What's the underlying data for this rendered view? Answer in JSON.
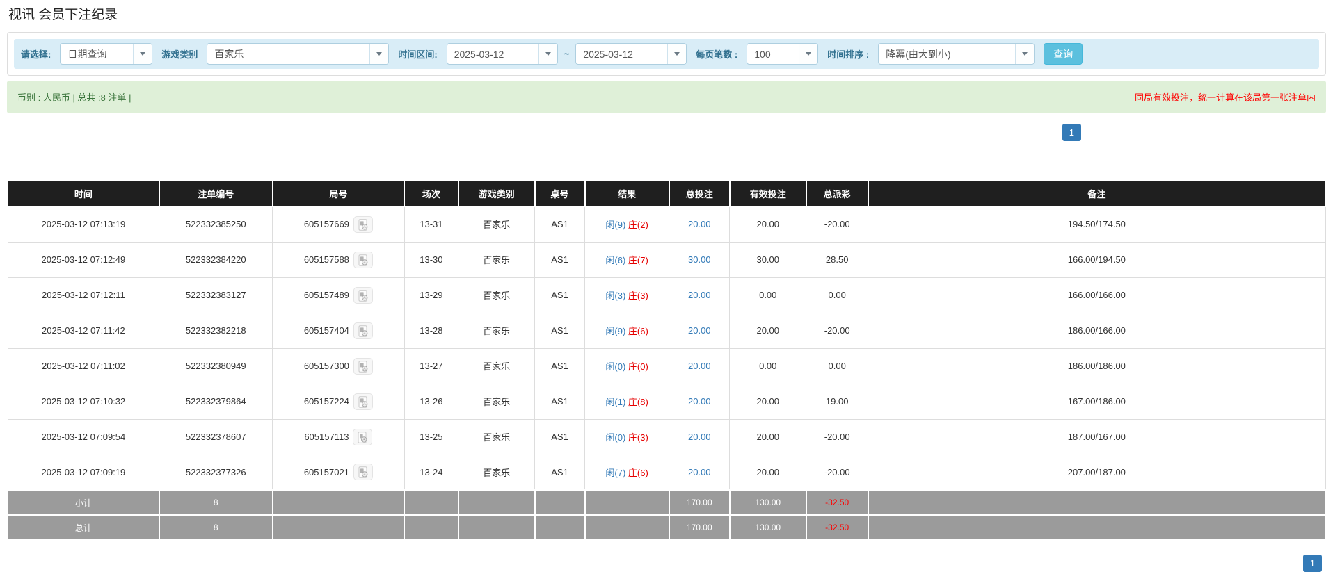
{
  "page": {
    "title": "视讯 会员下注纪录"
  },
  "filters": {
    "select_label": "请选择:",
    "select_value": "日期查询",
    "game_type_label": "游戏类别",
    "game_type_value": "百家乐",
    "date_range_label": "时间区间:",
    "date_from": "2025-03-12",
    "date_to": "2025-03-12",
    "range_separator": "~",
    "page_size_label": "每页笔数 :",
    "page_size_value": "100",
    "sort_label": "时间排序 :",
    "sort_value": "降冪(由大到小)",
    "search_button": "查询"
  },
  "summary": {
    "left_text": "币别 : 人民币 | 总共 :8 注单 |",
    "right_notice": "同局有效投注，统一计算在该局第一张注单内"
  },
  "pagination": {
    "current_page": "1"
  },
  "table": {
    "headers": [
      "时间",
      "注单编号",
      "局号",
      "场次",
      "游戏类别",
      "桌号",
      "结果",
      "总投注",
      "有效投注",
      "总派彩",
      "备注"
    ],
    "rows": [
      {
        "time": "2025-03-12 07:13:19",
        "bet_id": "522332385250",
        "round_id": "605157669",
        "session": "13-31",
        "game": "百家乐",
        "table_no": "AS1",
        "result_player": "闲(9)",
        "result_banker": "庄(2)",
        "total_bet": "20.00",
        "valid_bet": "20.00",
        "payout": "-20.00",
        "remark": "194.50/174.50"
      },
      {
        "time": "2025-03-12 07:12:49",
        "bet_id": "522332384220",
        "round_id": "605157588",
        "session": "13-30",
        "game": "百家乐",
        "table_no": "AS1",
        "result_player": "闲(6)",
        "result_banker": "庄(7)",
        "total_bet": "30.00",
        "valid_bet": "30.00",
        "payout": "28.50",
        "remark": "166.00/194.50"
      },
      {
        "time": "2025-03-12 07:12:11",
        "bet_id": "522332383127",
        "round_id": "605157489",
        "session": "13-29",
        "game": "百家乐",
        "table_no": "AS1",
        "result_player": "闲(3)",
        "result_banker": "庄(3)",
        "total_bet": "20.00",
        "valid_bet": "0.00",
        "payout": "0.00",
        "remark": "166.00/166.00"
      },
      {
        "time": "2025-03-12 07:11:42",
        "bet_id": "522332382218",
        "round_id": "605157404",
        "session": "13-28",
        "game": "百家乐",
        "table_no": "AS1",
        "result_player": "闲(9)",
        "result_banker": "庄(6)",
        "total_bet": "20.00",
        "valid_bet": "20.00",
        "payout": "-20.00",
        "remark": "186.00/166.00"
      },
      {
        "time": "2025-03-12 07:11:02",
        "bet_id": "522332380949",
        "round_id": "605157300",
        "session": "13-27",
        "game": "百家乐",
        "table_no": "AS1",
        "result_player": "闲(0)",
        "result_banker": "庄(0)",
        "total_bet": "20.00",
        "valid_bet": "0.00",
        "payout": "0.00",
        "remark": "186.00/186.00"
      },
      {
        "time": "2025-03-12 07:10:32",
        "bet_id": "522332379864",
        "round_id": "605157224",
        "session": "13-26",
        "game": "百家乐",
        "table_no": "AS1",
        "result_player": "闲(1)",
        "result_banker": "庄(8)",
        "total_bet": "20.00",
        "valid_bet": "20.00",
        "payout": "19.00",
        "remark": "167.00/186.00"
      },
      {
        "time": "2025-03-12 07:09:54",
        "bet_id": "522332378607",
        "round_id": "605157113",
        "session": "13-25",
        "game": "百家乐",
        "table_no": "AS1",
        "result_player": "闲(0)",
        "result_banker": "庄(3)",
        "total_bet": "20.00",
        "valid_bet": "20.00",
        "payout": "-20.00",
        "remark": "187.00/167.00"
      },
      {
        "time": "2025-03-12 07:09:19",
        "bet_id": "522332377326",
        "round_id": "605157021",
        "session": "13-24",
        "game": "百家乐",
        "table_no": "AS1",
        "result_player": "闲(7)",
        "result_banker": "庄(6)",
        "total_bet": "20.00",
        "valid_bet": "20.00",
        "payout": "-20.00",
        "remark": "207.00/187.00"
      }
    ],
    "subtotal": {
      "label": "小计",
      "count": "8",
      "total_bet": "170.00",
      "valid_bet": "130.00",
      "payout": "-32.50"
    },
    "total": {
      "label": "总计",
      "count": "8",
      "total_bet": "170.00",
      "valid_bet": "130.00",
      "payout": "-32.50"
    }
  },
  "icons": {
    "video_replay": "video-file-icon",
    "dropdown_arrow": "chevron-down-icon"
  },
  "colors": {
    "link_blue": "#337ab7",
    "player_blue": "#337ab7",
    "banker_red": "#e60000",
    "negative_red": "#ff0000",
    "filter_bar_bg": "#d9edf7",
    "filter_label": "#31708f",
    "summary_bar_bg": "#dff0d8",
    "summary_text": "#3c763d",
    "table_header_bg": "#1f1f1f",
    "totals_row_bg": "#9b9b9b",
    "search_button_bg": "#5bc0de",
    "pagination_active_bg": "#337ab7"
  }
}
